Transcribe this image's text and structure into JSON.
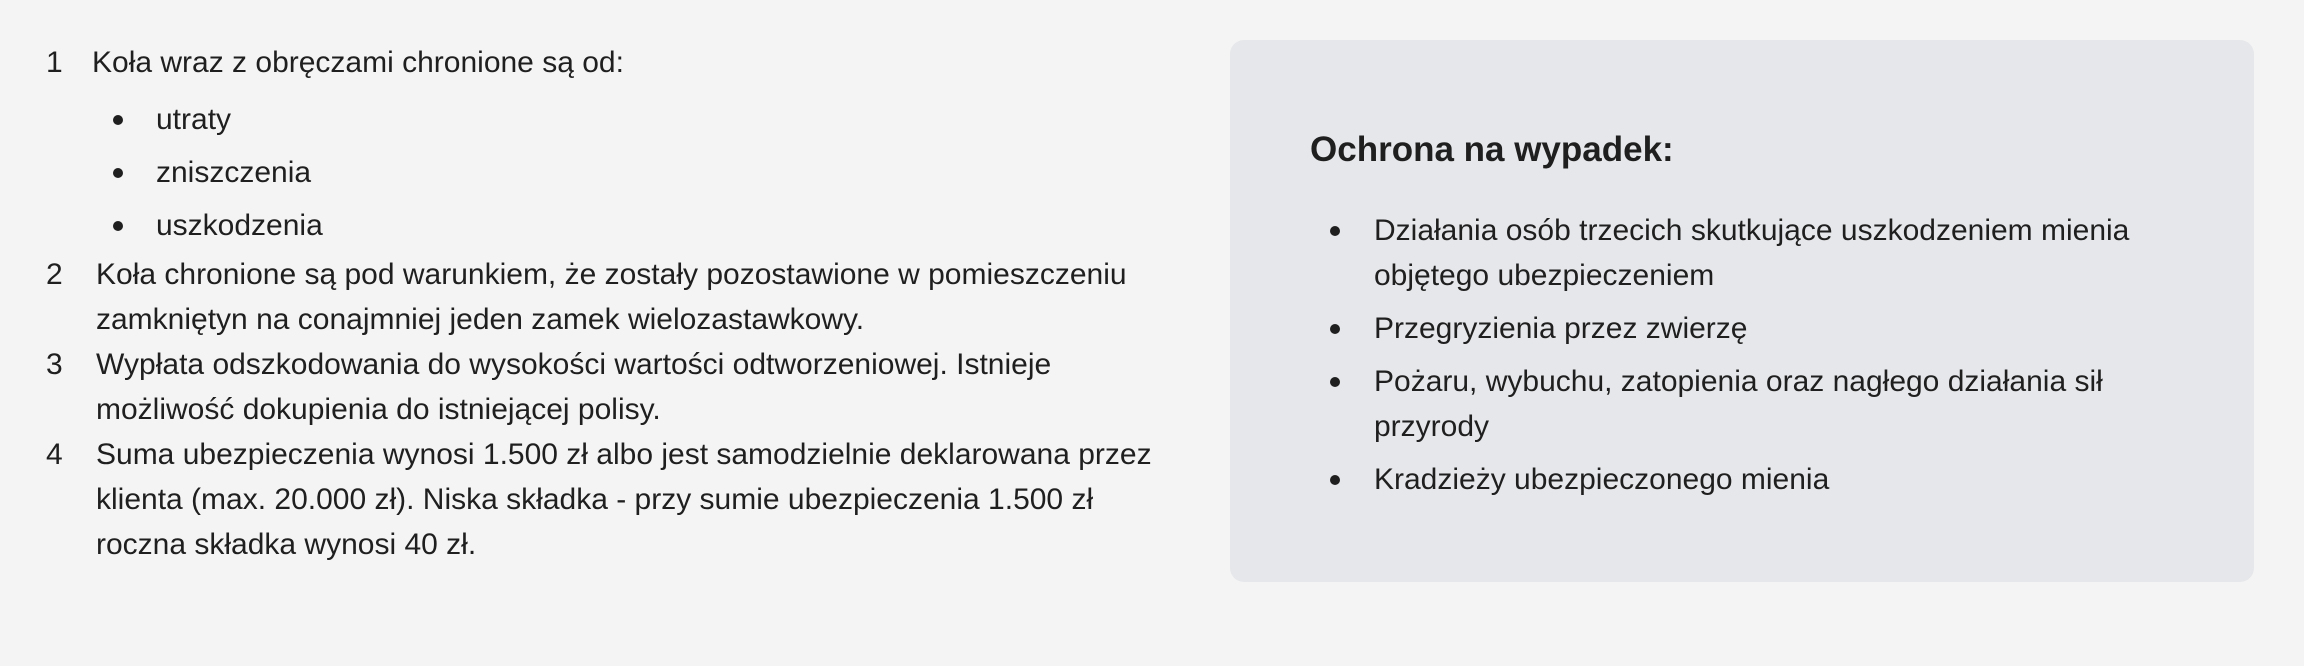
{
  "left_list": {
    "items": [
      {
        "number": "1",
        "text": "Koła wraz z obręczami chronione są od:",
        "sub_items": [
          "utraty",
          "zniszczenia",
          "uszkodzenia"
        ]
      },
      {
        "number": "2",
        "text": "Koła chronione są pod warunkiem, że zostały pozostawione w pomieszczeniu zamkniętyn na conajmniej jeden zamek wielozastawkowy."
      },
      {
        "number": "3",
        "text": "Wypłata odszkodowania do wysokości wartości odtworzeniowej. Istnieje możliwość dokupienia do istniejącej polisy."
      },
      {
        "number": "4",
        "text": "Suma ubezpieczenia wynosi 1.500 zł albo jest samodzielnie deklarowana przez klienta (max. 20.000 zł). Niska składka - przy sumie ubezpieczenia 1.500 zł roczna składka wynosi 40 zł."
      }
    ]
  },
  "protection_card": {
    "title": "Ochrona na wypadek:",
    "items": [
      "Działania osób trzecich skutkujące uszkodzeniem mienia objętego ubezpieczeniem",
      "Przegryzienia przez zwierzę",
      "Pożaru, wybuchu, zatopienia oraz nagłego działania sił przyrody",
      "Kradzieży ubezpieczonego mienia"
    ]
  }
}
